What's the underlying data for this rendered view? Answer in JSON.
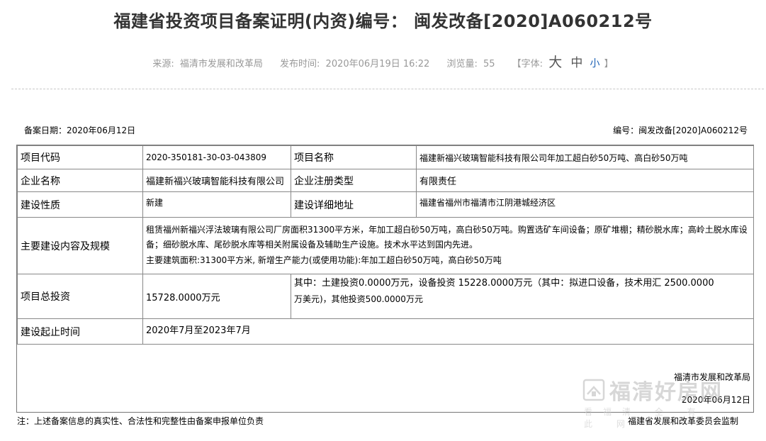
{
  "page": {
    "title": "福建省投资项目备案证明(内资)编号： 闽发改备[2020]A060212号"
  },
  "meta": {
    "source_label": "来源:",
    "source": "福清市发展和改革局",
    "published_label": "发布时间:",
    "published": "2020年06月19日 16:22",
    "views_label": "浏览量:",
    "views": "55",
    "font_open": "【字体:",
    "font_big": "大",
    "font_mid": "中",
    "font_small": "小",
    "font_close": "】"
  },
  "record": {
    "date_label": "备案日期：",
    "date": "2020年06月12日",
    "number_label": "编号：",
    "number": "闽发改备[2020]A060212号"
  },
  "table": {
    "project_code_label": "项目代码",
    "project_code": "2020-350181-30-03-043809",
    "project_name_label": "项目名称",
    "project_name": "福建新福兴玻璃智能科技有限公司年加工超白砂50万吨、高白砂50万吨",
    "company_label": "企业名称",
    "company": "福建新福兴玻璃智能科技有限公司",
    "reg_type_label": "企业注册类型",
    "reg_type": "有限责任",
    "nature_label": "建设性质",
    "nature": "新建",
    "address_label": "建设详细地址",
    "address": "福建省福州市福清市江阴港城经济区",
    "scope_label": "主要建设内容及规模",
    "scope_p1": "租赁福州新福兴浮法玻璃有限公司厂房面积31300平方米，年加工超白砂50万吨，高白砂50万吨。购置选矿车间设备；原矿堆棚；精砂脱水库；高岭土脱水库设备；细砂脱水库、尾砂脱水库等相关附属设备及辅助生产设施。技术水平达到国内先进。",
    "scope_p2": "主要建筑面积:31300平方米, 新增生产能力(或使用功能):年加工超白砂50万吨，高白砂50万吨",
    "invest_label": "项目总投资",
    "invest_total": "15728.0000万元",
    "invest_detail_1": "其中：土建投资0.0000万元，设备投资 15228.0000万元（其中：拟进口设备，技术用汇 2500.0000",
    "invest_detail_2": "万美元)，其他投资500.0000万元",
    "period_label": "建设起止时间",
    "period": "2020年7月至2023年7月"
  },
  "issuer": {
    "name": "福清市发展和改革局",
    "date": "2020年06月12日"
  },
  "footer": {
    "note": "注：上述备案信息的真实性、合法性和完整性由备案申报单位负责",
    "supervisor": "福建省发展和改革委员会监制"
  },
  "watermark": {
    "main": "福清好房网",
    "sub": "看福清 全 有 此 网"
  }
}
